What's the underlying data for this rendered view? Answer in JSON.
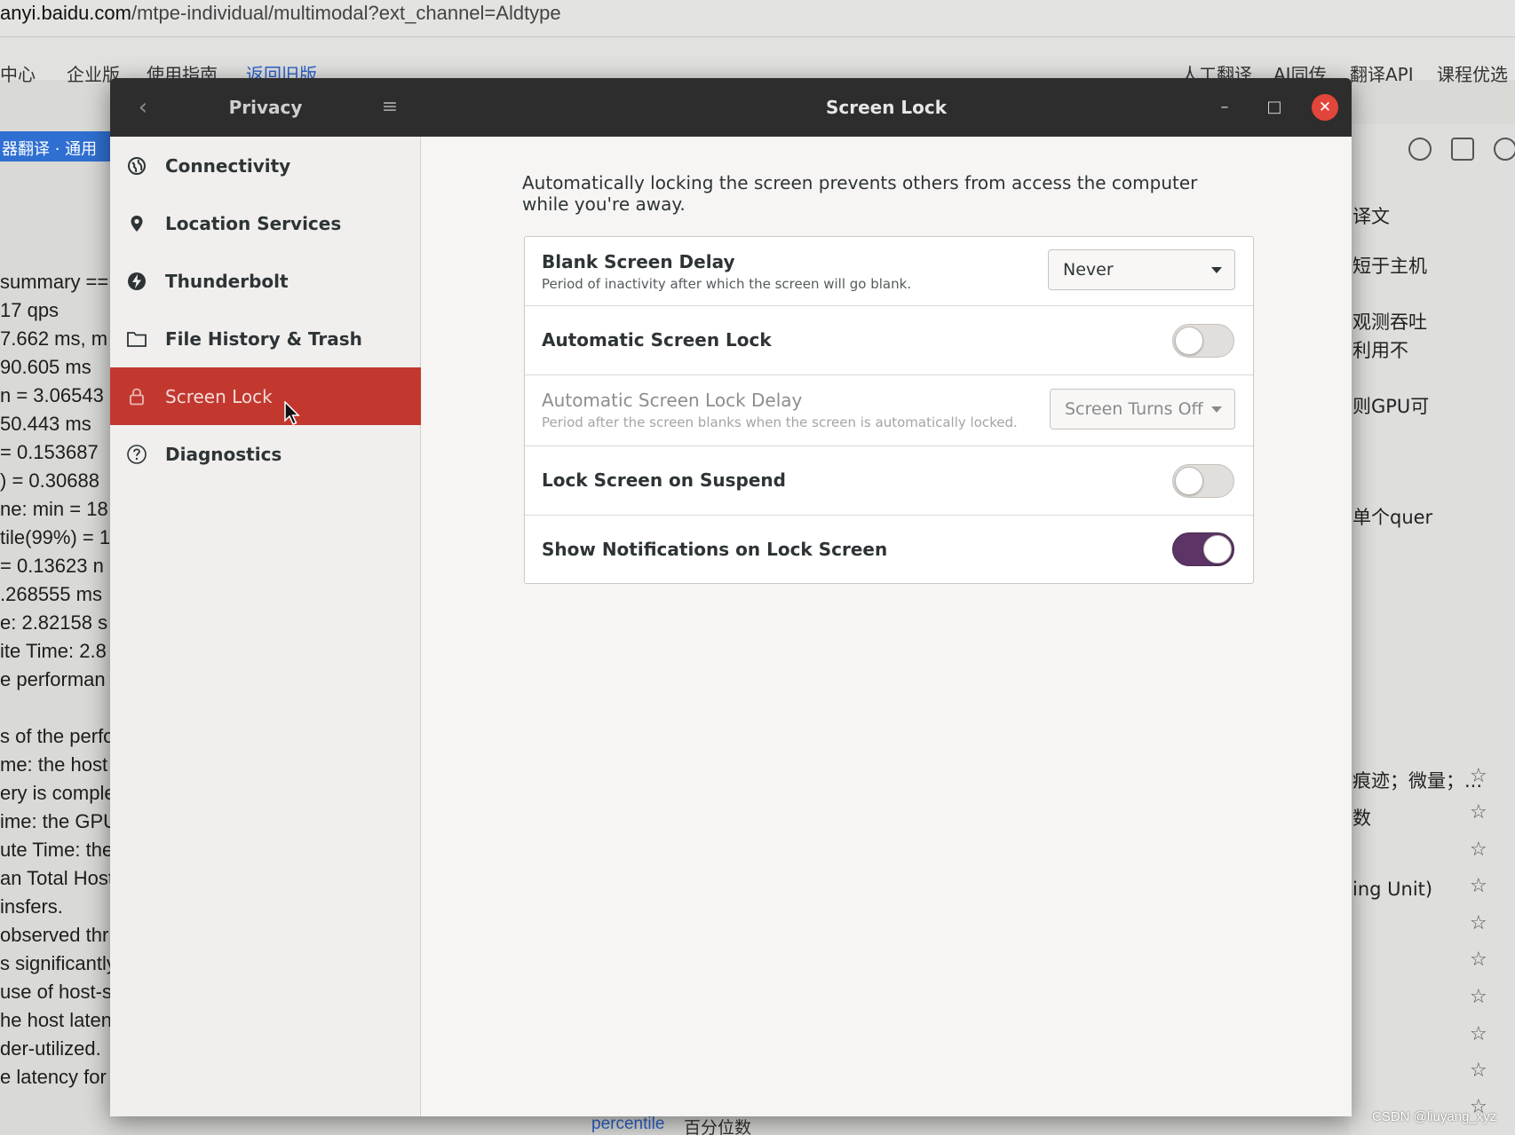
{
  "background_browser": {
    "url_host": "anyi.baidu.com",
    "url_path": "/mtpe-individual/multimodal?ext_channel=Aldtype",
    "nav_items": [
      "中心",
      "企业版",
      "使用指南",
      "返回旧版",
      "人工翻译",
      "AI同传",
      "翻译API",
      "课程优选"
    ],
    "tab_label": "器翻译 · 通用",
    "left_text_lines": [
      "summary ==",
      "17 qps",
      "7.662 ms, m",
      "90.605 ms",
      "n = 3.06543",
      "50.443 ms",
      "= 0.153687",
      ") = 0.30688",
      "ne: min = 18",
      "tile(99%) = 1",
      "= 0.13623 n",
      ".268555 ms",
      "e: 2.82158 s",
      "ite Time: 2.8",
      "e performan",
      "",
      "s of the perfo",
      "me: the host",
      "ery is comple",
      "ime: the GPU",
      "ute Time: the",
      "an Total Host",
      "insfers.",
      "observed thr",
      "s significantly",
      "use of host-s",
      "he host laten",
      "der-utilized.",
      "e latency for"
    ],
    "right_texts": [
      "译文",
      "短于主机",
      "观测吞吐",
      "利用不",
      "则GPU可",
      "单个quer",
      "痕迹；微量；...",
      "数",
      "ing Unit)"
    ],
    "bottom_link": "percentile",
    "bottom_text": "百分位数",
    "watermark": "CSDN @liuyang_xyz"
  },
  "window": {
    "sidebar_title": "Privacy",
    "title": "Screen Lock",
    "back_icon": "‹",
    "menu_icon": "≡",
    "minimize_icon": "–",
    "maximize_icon": "□",
    "close_icon": "✕",
    "accent_color": "#c2382f",
    "toggle_on_color": "#5c3566"
  },
  "sidebar": {
    "items": [
      {
        "label": "Connectivity",
        "icon": "globe-icon"
      },
      {
        "label": "Location Services",
        "icon": "location-pin-icon"
      },
      {
        "label": "Thunderbolt",
        "icon": "thunderbolt-icon"
      },
      {
        "label": "File History & Trash",
        "icon": "folder-icon"
      },
      {
        "label": "Screen Lock",
        "icon": "lock-icon",
        "active": true
      },
      {
        "label": "Diagnostics",
        "icon": "help-icon"
      }
    ]
  },
  "content": {
    "description": "Automatically locking the screen prevents others from access the computer while you're away.",
    "rows": {
      "blank_delay": {
        "title": "Blank Screen Delay",
        "subtitle": "Period of inactivity after which the screen will go blank.",
        "value": "Never"
      },
      "auto_lock": {
        "title": "Automatic Screen Lock",
        "enabled": false
      },
      "auto_lock_delay": {
        "title": "Automatic Screen Lock Delay",
        "subtitle": "Period after the screen blanks when the screen is automatically locked.",
        "value": "Screen Turns Off"
      },
      "lock_on_suspend": {
        "title": "Lock Screen on Suspend",
        "enabled": false
      },
      "show_notifications": {
        "title": "Show Notifications on Lock Screen",
        "enabled": true
      }
    }
  }
}
